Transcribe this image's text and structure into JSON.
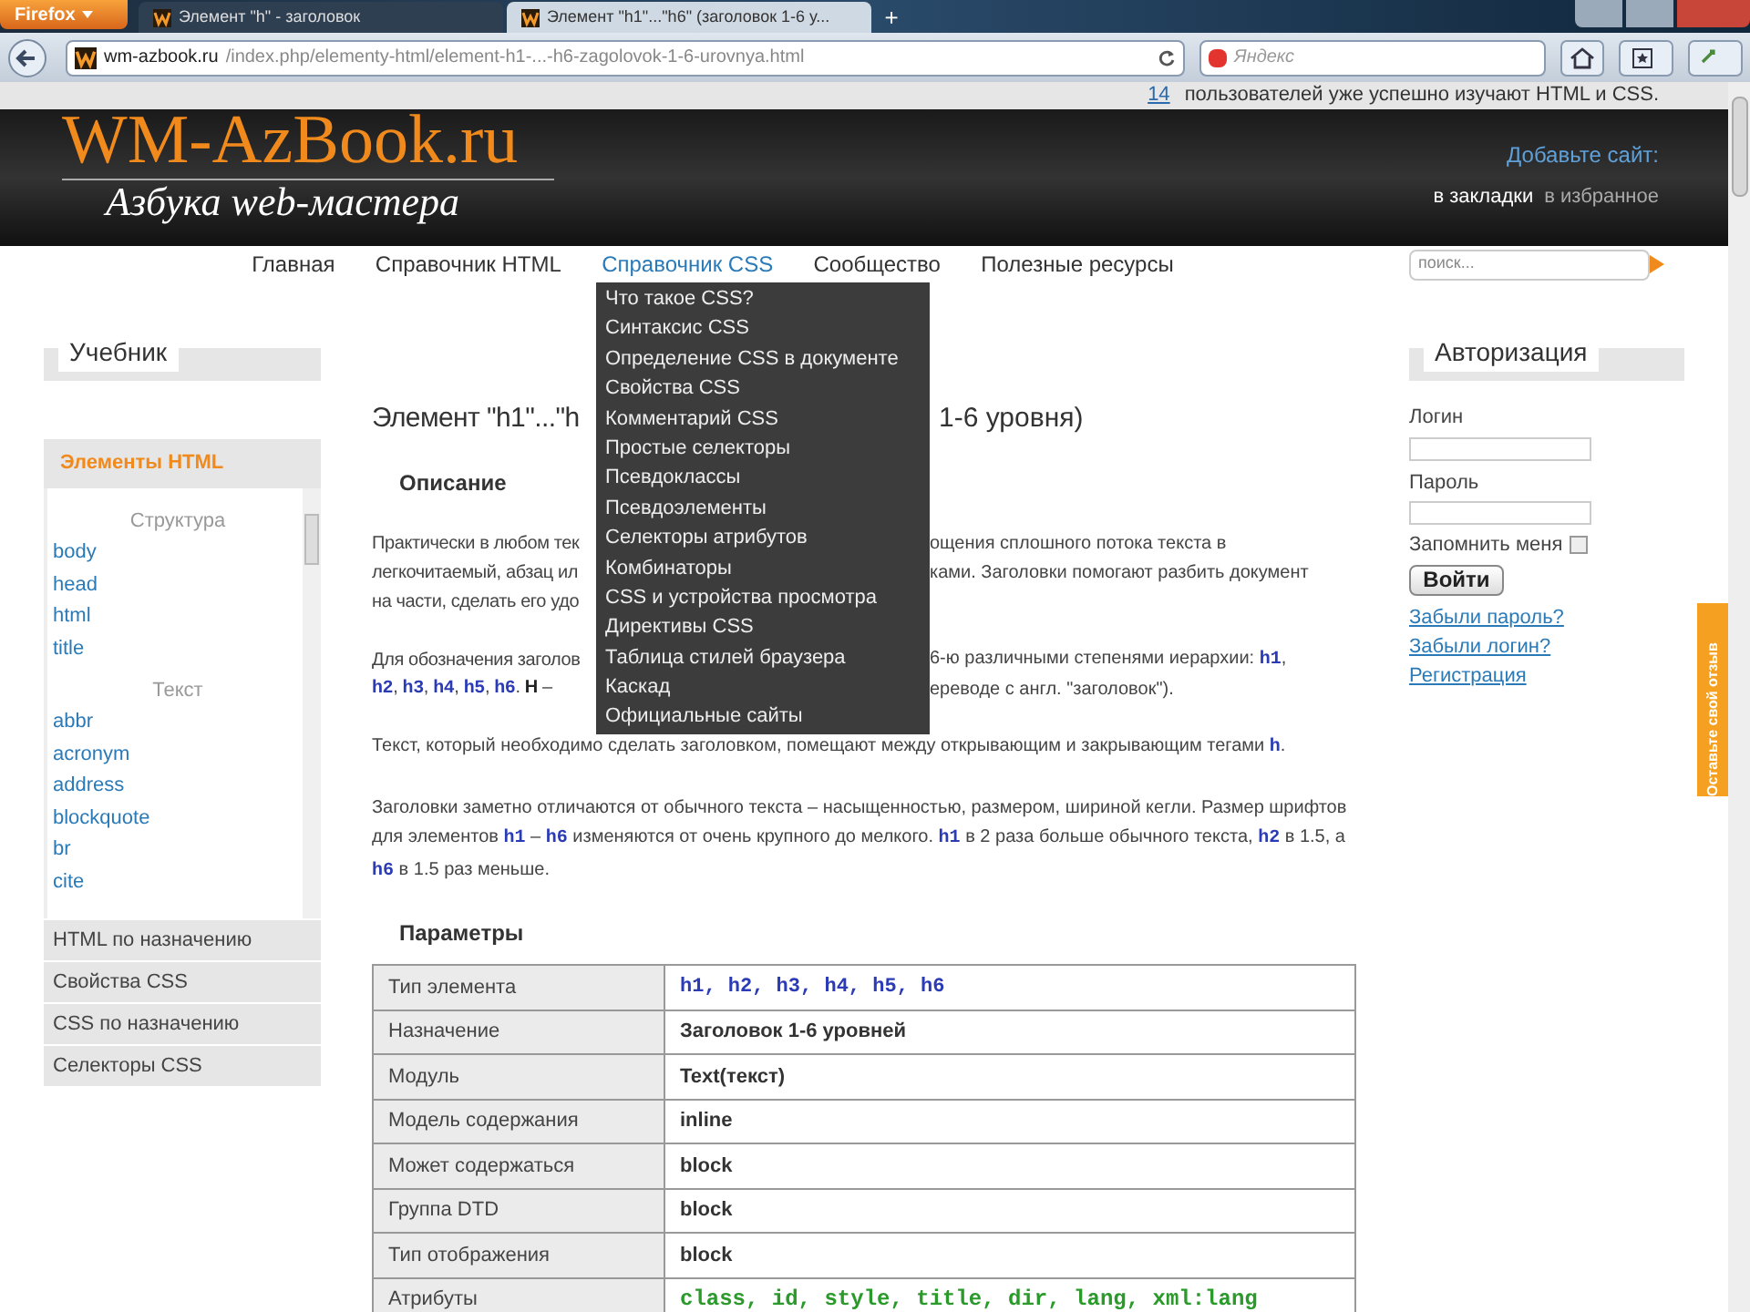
{
  "browser": {
    "app_button": "Firefox",
    "tabs": [
      {
        "title": "Элемент \"h\" - заголовок",
        "selected": false
      },
      {
        "title": "Элемент \"h1\"...\"h6\" (заголовок 1-6 у...",
        "selected": true
      }
    ],
    "new_tab": "+",
    "url": {
      "domain": "wm-azbook.ru",
      "path": "/index.php/elementy-html/element-h1-...-h6-zagolovok-1-6-urovnya.html"
    },
    "search_placeholder": "Яндекс"
  },
  "site": {
    "users_count": "14",
    "users_text": "пользователей уже успешно изучают HTML и CSS.",
    "logo": "WM-AzBook.ru",
    "tagline": "Азбука web-мастера",
    "add_site": "Добавьте сайт:",
    "bookmark_links": [
      "в закладки",
      "в избранное"
    ],
    "nav": [
      {
        "label": "Главная",
        "selected": false
      },
      {
        "label": "Справочник HTML",
        "selected": false
      },
      {
        "label": "Справочник CSS",
        "selected": true
      },
      {
        "label": "Сообщество",
        "selected": false
      },
      {
        "label": "Полезные ресурсы",
        "selected": false
      }
    ],
    "search_placeholder": "поиск...",
    "dropdown": [
      "Что такое CSS?",
      "Синтаксис CSS",
      "Определение CSS в документе",
      "Свойства CSS",
      "Комментарий CSS",
      "Простые селекторы",
      "Псевдоклассы",
      "Псевдоэлементы",
      "Селекторы атрибутов",
      "Комбинаторы",
      "CSS и устройства просмотра",
      "Директивы CSS",
      "Таблица стилей браузера",
      "Каскад",
      "Официальные сайты"
    ]
  },
  "left": {
    "title": "Учебник",
    "section": "Элементы HTML",
    "groups": [
      {
        "heading": "Структура",
        "items": [
          "body",
          "head",
          "html",
          "title"
        ]
      },
      {
        "heading": "Текст",
        "items": [
          "abbr",
          "acronym",
          "address",
          "blockquote",
          "br",
          "cite"
        ]
      }
    ],
    "categories": [
      "HTML по назначению",
      "Свойства CSS",
      "CSS по назначению",
      "Селекторы CSS"
    ]
  },
  "main": {
    "heading_left": "Элемент \"h1\"...\"h",
    "heading_right": "1-6 уровня)",
    "description_title": "Описание",
    "paragraphs": [
      {
        "kind": "split",
        "lines": [
          {
            "left": [
              {
                "kind": "text",
                "text": "Практически в любом тек"
              }
            ],
            "right": [
              {
                "kind": "text",
                "text": "ощения сплошного потока текста в"
              }
            ]
          },
          {
            "left": [
              {
                "kind": "text",
                "text": "легкочитаемый, абзац ил"
              }
            ],
            "right": [
              {
                "kind": "text",
                "text": "ками. Заголовки помогают разбить документ"
              }
            ]
          },
          {
            "left": [
              {
                "kind": "text",
                "text": "на части, сделать его удо"
              }
            ]
          }
        ]
      },
      {
        "kind": "split",
        "lines": [
          {
            "left": [
              {
                "kind": "text",
                "text": "Для обозначения заголов"
              }
            ],
            "right": [
              {
                "kind": "text",
                "text": "6-ю различными степенями иерархии: "
              },
              {
                "kind": "code",
                "text": "h1"
              },
              {
                "kind": "text",
                "text": ","
              }
            ]
          },
          {
            "left": [
              {
                "kind": "code",
                "text": "h2"
              },
              {
                "kind": "text",
                "text": ", "
              },
              {
                "kind": "code",
                "text": "h3"
              },
              {
                "kind": "text",
                "text": ", "
              },
              {
                "kind": "code",
                "text": "h4"
              },
              {
                "kind": "text",
                "text": ", "
              },
              {
                "kind": "code",
                "text": "h5"
              },
              {
                "kind": "text",
                "text": ", "
              },
              {
                "kind": "code",
                "text": "h6"
              },
              {
                "kind": "text",
                "text": ". "
              },
              {
                "kind": "bold",
                "text": "Н"
              },
              {
                "kind": "text",
                "text": " –"
              }
            ],
            "right": [
              {
                "kind": "text",
                "text": "ереводе с англ. \"заголовок\")."
              }
            ]
          }
        ]
      },
      {
        "kind": "full",
        "segments": [
          {
            "kind": "text",
            "text": "Текст, который необходимо сделать заголовком, помещают между открывающим и закрывающим тегами "
          },
          {
            "kind": "code",
            "text": "h"
          },
          {
            "kind": "text",
            "text": "."
          }
        ]
      },
      {
        "kind": "full",
        "segments": [
          {
            "kind": "text",
            "text": "Заголовки заметно отличаются от обычного текста – насыщенностью, размером, шириной кегли. Размер шрифтов для элементов "
          },
          {
            "kind": "code",
            "text": "h1"
          },
          {
            "kind": "text",
            "text": " – "
          },
          {
            "kind": "code",
            "text": "h6"
          },
          {
            "kind": "text",
            "text": " изменяются от очень крупного до мелкого. "
          },
          {
            "kind": "code",
            "text": "h1"
          },
          {
            "kind": "text",
            "text": " в 2 раза больше обычного текста, "
          },
          {
            "kind": "code",
            "text": "h2"
          },
          {
            "kind": "text",
            "text": " в 1.5, а "
          },
          {
            "kind": "code",
            "text": "h6"
          },
          {
            "kind": "text",
            "text": " в 1.5 раз меньше."
          }
        ]
      }
    ],
    "params_title": "Параметры",
    "params": [
      {
        "label": "Тип элемента",
        "value": "h1, h2, h3, h4, h5, h6",
        "kind": "tags"
      },
      {
        "label": "Назначение",
        "value": "Заголовок 1-6 уровней",
        "kind": "bold"
      },
      {
        "label": "Модуль",
        "value": "Text(текст)",
        "kind": "bold"
      },
      {
        "label": "Модель содержания",
        "value": "inline",
        "kind": "bold"
      },
      {
        "label": "Может содержаться",
        "value": "block",
        "kind": "bold"
      },
      {
        "label": "Группа DTD",
        "value": "block",
        "kind": "bold"
      },
      {
        "label": "Тип отображения",
        "value": "block",
        "kind": "bold"
      },
      {
        "label": "Атрибуты",
        "value": "class, id, style, title, dir, lang, xml:lang",
        "kind": "attrs"
      }
    ]
  },
  "right": {
    "title": "Авторизация",
    "login_label": "Логин",
    "password_label": "Пароль",
    "remember_label": "Запомнить меня",
    "remember_checked": false,
    "submit": "Войти",
    "links": [
      "Забыли пароль?",
      "Забыли логин?",
      "Регистрация"
    ],
    "feedback": "Оставьте свой отзыв"
  }
}
